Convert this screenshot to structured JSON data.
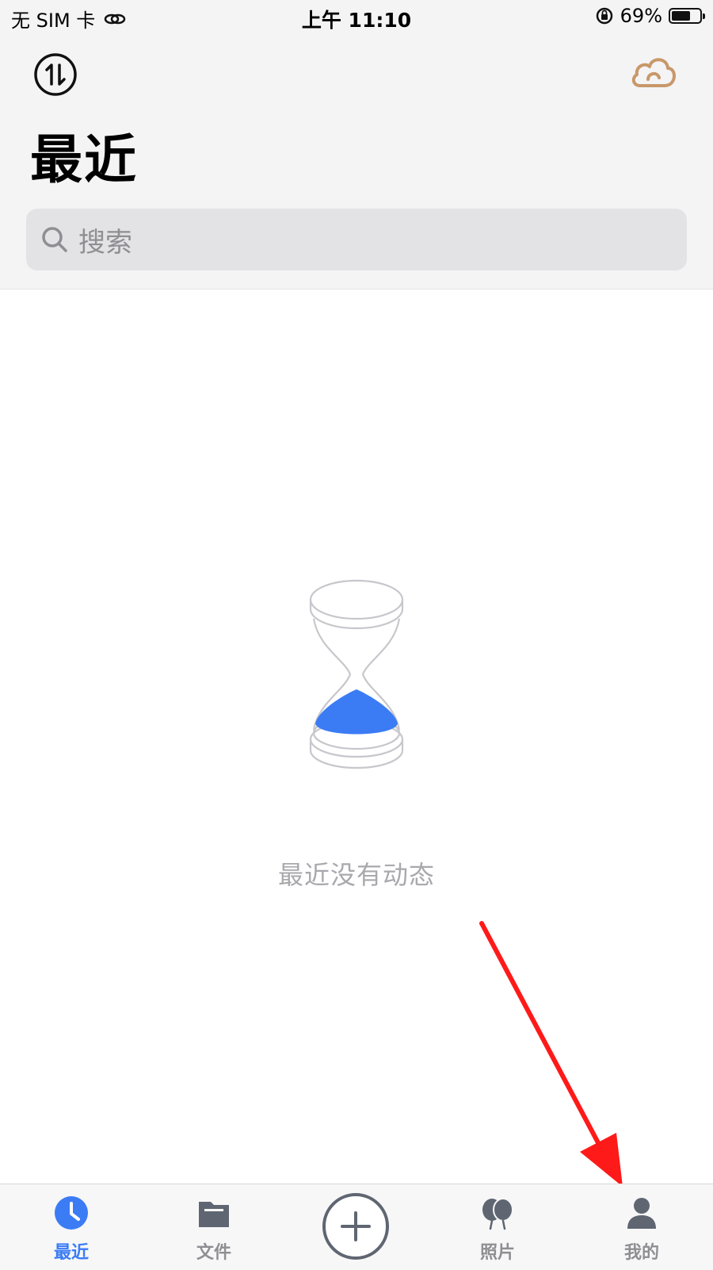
{
  "status_bar": {
    "carrier": "无 SIM 卡",
    "time": "上午 11:10",
    "battery_percent": "69%",
    "battery_level": 0.69
  },
  "header": {
    "title": "最近",
    "sync_icon": "sync-icon",
    "cloud_icon": "cloud-icon"
  },
  "search": {
    "placeholder": "搜索"
  },
  "empty_state": {
    "icon": "hourglass-icon",
    "message": "最近没有动态"
  },
  "tabbar": {
    "tabs": [
      {
        "label": "最近",
        "icon": "clock-icon",
        "active": true
      },
      {
        "label": "文件",
        "icon": "folder-icon",
        "active": false
      },
      {
        "label": "",
        "icon": "plus-icon",
        "active": false
      },
      {
        "label": "照片",
        "icon": "photos-icon",
        "active": false
      },
      {
        "label": "我的",
        "icon": "person-icon",
        "active": false
      }
    ]
  },
  "colors": {
    "accent": "#3b7cf5",
    "cloud": "#c8986a",
    "annotation_arrow": "#ff1a1a"
  }
}
